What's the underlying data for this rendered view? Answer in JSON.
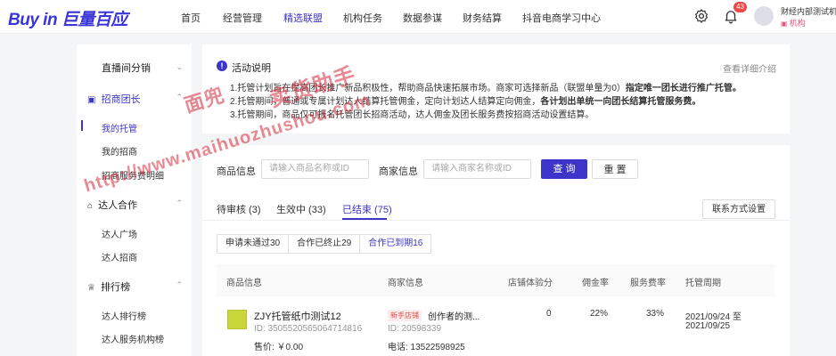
{
  "header": {
    "logo": "Buy in 巨量百应",
    "nav": [
      "首页",
      "经营管理",
      "精选联盟",
      "机构任务",
      "数据参谋",
      "财务结算",
      "抖音电商学习中心"
    ],
    "active_nav": "精选联盟",
    "notification_count": "43",
    "user_name": "财经内部测试机",
    "user_role": "机构"
  },
  "sidebar": {
    "groups": [
      {
        "label": "直播间分销",
        "items": []
      },
      {
        "label": "招商团长",
        "items": [
          "我的托管",
          "我的招商",
          "招商服务费明细"
        ]
      },
      {
        "label": "达人合作",
        "items": [
          "达人广场",
          "达人招商"
        ]
      },
      {
        "label": "排行榜",
        "items": [
          "达人排行榜",
          "达人服务机构榜"
        ]
      }
    ],
    "active_item": "我的托管"
  },
  "notice": {
    "title": "活动说明",
    "detail_link": "查看详细介绍",
    "line1_a": "1.托管计划旨在提高团长推广新品积极性，帮助商品快速拓展市场。商家可选择新品（联盟单量为0）",
    "line1_b": "指定唯一团长进行推广托管。",
    "line2_a": "2.托管期间，普通或专属计划达人结算托管佣金，定向计划达人结算定向佣金，",
    "line2_b": "各计划出单统一向团长结算托管服务费。",
    "line3": "3.托管期间，商品仅可报名托管团长招商活动，达人佣金及团长服务费按招商活动设置结算。"
  },
  "filters": {
    "product_label": "商品信息",
    "product_placeholder": "请输入商品名称或ID",
    "merchant_label": "商家信息",
    "merchant_placeholder": "请输入商家名称或ID",
    "search_btn": "查 询",
    "reset_btn": "重 置"
  },
  "tabs": [
    "待审核 (3)",
    "生效中 (33)",
    "已结束 (75)"
  ],
  "active_tab": "已结束 (75)",
  "contact_btn": "联系方式设置",
  "subtabs": [
    "申请未通过30",
    "合作已终止29",
    "合作已到期16"
  ],
  "active_subtab": "合作已到期16",
  "table": {
    "columns": [
      "商品信息",
      "商家信息",
      "店铺体验分",
      "佣金率",
      "服务费率",
      "托管周期"
    ],
    "rows": [
      {
        "product_name": "ZJY托管纸巾测试12",
        "product_id": "ID: 3505520565064714816",
        "price": "售价: ￥0.00",
        "merchant_tag": "新手店铺",
        "merchant_name": "创作者的测...",
        "merchant_id": "ID: 20598339",
        "phone": "电话: 13522598925",
        "score": "0",
        "commission": "22%",
        "service_fee": "33%",
        "period_start": "2021/09/24 至",
        "period_end": "2021/09/25"
      }
    ]
  },
  "watermark": [
    "面兜",
    "卖货助手",
    "http://www.maihuozhushou.com"
  ],
  "colors": {
    "accent": "#3d35c9",
    "tag": "#e14d4d",
    "badge": "#f04646"
  }
}
